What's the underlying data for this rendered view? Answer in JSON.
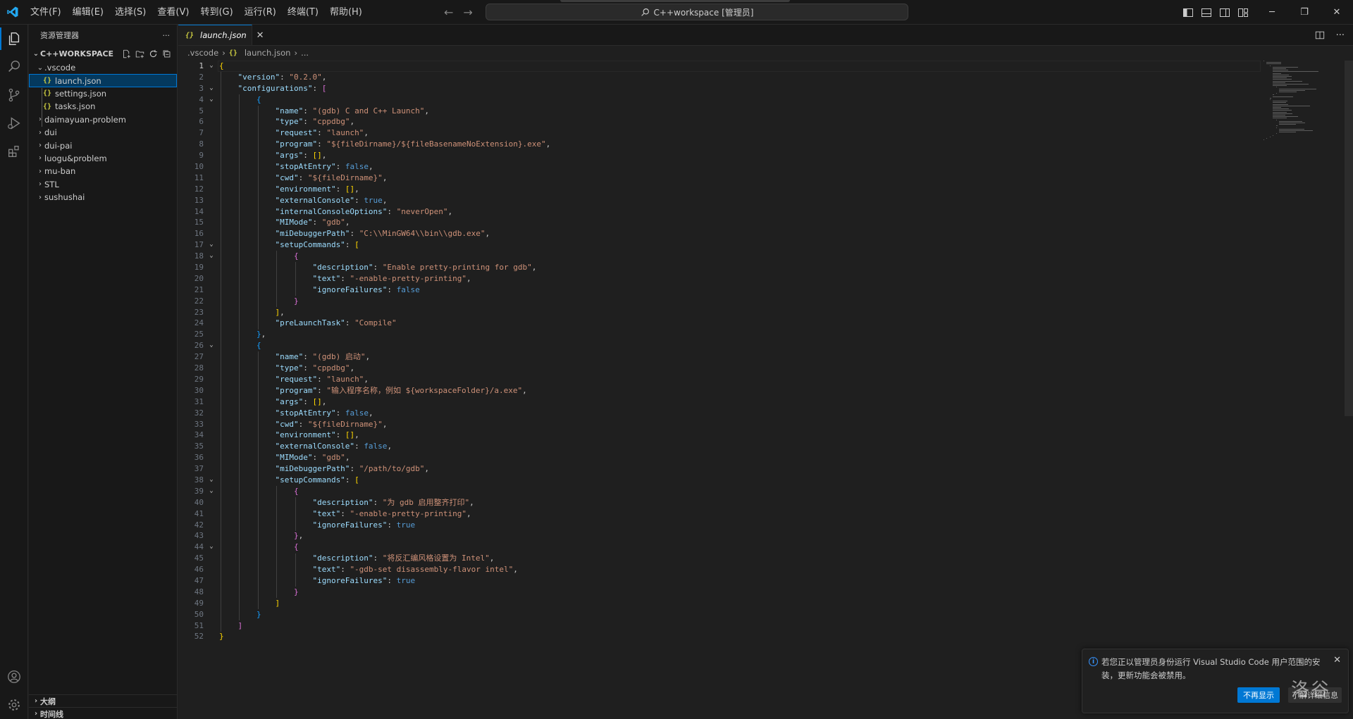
{
  "titlebar": {
    "menu": [
      "文件(F)",
      "编辑(E)",
      "选择(S)",
      "查看(V)",
      "转到(G)",
      "运行(R)",
      "终端(T)",
      "帮助(H)"
    ],
    "command_center": "C++workspace [管理员]"
  },
  "sidebar": {
    "title": "资源管理器",
    "more": "···",
    "workspace": "C++WORKSPACE",
    "folder_open": ".vscode",
    "files": [
      "launch.json",
      "settings.json",
      "tasks.json"
    ],
    "folders": [
      "daimayuan-problem",
      "dui",
      "dui-pai",
      "luogu&problem",
      "mu-ban",
      "STL",
      "sushushai"
    ],
    "outline": "大纲",
    "timeline": "时间线"
  },
  "editor": {
    "tab": "launch.json",
    "breadcrumb": [
      ".vscode",
      "launch.json",
      "..."
    ],
    "active_line": 1,
    "lines": [
      [
        [
          "b1",
          "{"
        ]
      ],
      [
        [
          "key",
          "    \"version\""
        ],
        [
          "p",
          ": "
        ],
        [
          "str",
          "\"0.2.0\""
        ],
        [
          "p",
          ","
        ]
      ],
      [
        [
          "key",
          "    \"configurations\""
        ],
        [
          "p",
          ": "
        ],
        [
          "b2",
          "["
        ]
      ],
      [
        [
          "p",
          "        "
        ],
        [
          "b3",
          "{"
        ]
      ],
      [
        [
          "key",
          "            \"name\""
        ],
        [
          "p",
          ": "
        ],
        [
          "str",
          "\"(gdb) C and C++ Launch\""
        ],
        [
          "p",
          ","
        ]
      ],
      [
        [
          "key",
          "            \"type\""
        ],
        [
          "p",
          ": "
        ],
        [
          "str",
          "\"cppdbg\""
        ],
        [
          "p",
          ","
        ]
      ],
      [
        [
          "key",
          "            \"request\""
        ],
        [
          "p",
          ": "
        ],
        [
          "str",
          "\"launch\""
        ],
        [
          "p",
          ","
        ]
      ],
      [
        [
          "key",
          "            \"program\""
        ],
        [
          "p",
          ": "
        ],
        [
          "str",
          "\"${fileDirname}/${fileBasenameNoExtension}.exe\""
        ],
        [
          "p",
          ","
        ]
      ],
      [
        [
          "key",
          "            \"args\""
        ],
        [
          "p",
          ": "
        ],
        [
          "b1",
          "[]"
        ],
        [
          "p",
          ","
        ]
      ],
      [
        [
          "key",
          "            \"stopAtEntry\""
        ],
        [
          "p",
          ": "
        ],
        [
          "kw",
          "false"
        ],
        [
          "p",
          ","
        ]
      ],
      [
        [
          "key",
          "            \"cwd\""
        ],
        [
          "p",
          ": "
        ],
        [
          "str",
          "\"${fileDirname}\""
        ],
        [
          "p",
          ","
        ]
      ],
      [
        [
          "key",
          "            \"environment\""
        ],
        [
          "p",
          ": "
        ],
        [
          "b1",
          "[]"
        ],
        [
          "p",
          ","
        ]
      ],
      [
        [
          "key",
          "            \"externalConsole\""
        ],
        [
          "p",
          ": "
        ],
        [
          "kw",
          "true"
        ],
        [
          "p",
          ","
        ]
      ],
      [
        [
          "key",
          "            \"internalConsoleOptions\""
        ],
        [
          "p",
          ": "
        ],
        [
          "str",
          "\"neverOpen\""
        ],
        [
          "p",
          ","
        ]
      ],
      [
        [
          "key",
          "            \"MIMode\""
        ],
        [
          "p",
          ": "
        ],
        [
          "str",
          "\"gdb\""
        ],
        [
          "p",
          ","
        ]
      ],
      [
        [
          "key",
          "            \"miDebuggerPath\""
        ],
        [
          "p",
          ": "
        ],
        [
          "str",
          "\"C:\\\\MinGW64\\\\bin\\\\gdb.exe\""
        ],
        [
          "p",
          ","
        ]
      ],
      [
        [
          "key",
          "            \"setupCommands\""
        ],
        [
          "p",
          ": "
        ],
        [
          "b1",
          "["
        ]
      ],
      [
        [
          "p",
          "                "
        ],
        [
          "b2",
          "{"
        ]
      ],
      [
        [
          "key",
          "                    \"description\""
        ],
        [
          "p",
          ": "
        ],
        [
          "str",
          "\"Enable pretty-printing for gdb\""
        ],
        [
          "p",
          ","
        ]
      ],
      [
        [
          "key",
          "                    \"text\""
        ],
        [
          "p",
          ": "
        ],
        [
          "str",
          "\"-enable-pretty-printing\""
        ],
        [
          "p",
          ","
        ]
      ],
      [
        [
          "key",
          "                    \"ignoreFailures\""
        ],
        [
          "p",
          ": "
        ],
        [
          "kw",
          "false"
        ]
      ],
      [
        [
          "p",
          "                "
        ],
        [
          "b2",
          "}"
        ]
      ],
      [
        [
          "p",
          "            "
        ],
        [
          "b1",
          "]"
        ],
        [
          "p",
          ","
        ]
      ],
      [
        [
          "key",
          "            \"preLaunchTask\""
        ],
        [
          "p",
          ": "
        ],
        [
          "str",
          "\"Compile\""
        ]
      ],
      [
        [
          "p",
          "        "
        ],
        [
          "b3",
          "}"
        ],
        [
          "p",
          ","
        ]
      ],
      [
        [
          "p",
          "        "
        ],
        [
          "b3",
          "{"
        ]
      ],
      [
        [
          "key",
          "            \"name\""
        ],
        [
          "p",
          ": "
        ],
        [
          "str",
          "\"(gdb) 启动\""
        ],
        [
          "p",
          ","
        ]
      ],
      [
        [
          "key",
          "            \"type\""
        ],
        [
          "p",
          ": "
        ],
        [
          "str",
          "\"cppdbg\""
        ],
        [
          "p",
          ","
        ]
      ],
      [
        [
          "key",
          "            \"request\""
        ],
        [
          "p",
          ": "
        ],
        [
          "str",
          "\"launch\""
        ],
        [
          "p",
          ","
        ]
      ],
      [
        [
          "key",
          "            \"program\""
        ],
        [
          "p",
          ": "
        ],
        [
          "str",
          "\"输入程序名称，例如 ${workspaceFolder}/a.exe\""
        ],
        [
          "p",
          ","
        ]
      ],
      [
        [
          "key",
          "            \"args\""
        ],
        [
          "p",
          ": "
        ],
        [
          "b1",
          "[]"
        ],
        [
          "p",
          ","
        ]
      ],
      [
        [
          "key",
          "            \"stopAtEntry\""
        ],
        [
          "p",
          ": "
        ],
        [
          "kw",
          "false"
        ],
        [
          "p",
          ","
        ]
      ],
      [
        [
          "key",
          "            \"cwd\""
        ],
        [
          "p",
          ": "
        ],
        [
          "str",
          "\"${fileDirname}\""
        ],
        [
          "p",
          ","
        ]
      ],
      [
        [
          "key",
          "            \"environment\""
        ],
        [
          "p",
          ": "
        ],
        [
          "b1",
          "[]"
        ],
        [
          "p",
          ","
        ]
      ],
      [
        [
          "key",
          "            \"externalConsole\""
        ],
        [
          "p",
          ": "
        ],
        [
          "kw",
          "false"
        ],
        [
          "p",
          ","
        ]
      ],
      [
        [
          "key",
          "            \"MIMode\""
        ],
        [
          "p",
          ": "
        ],
        [
          "str",
          "\"gdb\""
        ],
        [
          "p",
          ","
        ]
      ],
      [
        [
          "key",
          "            \"miDebuggerPath\""
        ],
        [
          "p",
          ": "
        ],
        [
          "str",
          "\"/path/to/gdb\""
        ],
        [
          "p",
          ","
        ]
      ],
      [
        [
          "key",
          "            \"setupCommands\""
        ],
        [
          "p",
          ": "
        ],
        [
          "b1",
          "["
        ]
      ],
      [
        [
          "p",
          "                "
        ],
        [
          "b2",
          "{"
        ]
      ],
      [
        [
          "key",
          "                    \"description\""
        ],
        [
          "p",
          ": "
        ],
        [
          "str",
          "\"为 gdb 启用整齐打印\""
        ],
        [
          "p",
          ","
        ]
      ],
      [
        [
          "key",
          "                    \"text\""
        ],
        [
          "p",
          ": "
        ],
        [
          "str",
          "\"-enable-pretty-printing\""
        ],
        [
          "p",
          ","
        ]
      ],
      [
        [
          "key",
          "                    \"ignoreFailures\""
        ],
        [
          "p",
          ": "
        ],
        [
          "kw",
          "true"
        ]
      ],
      [
        [
          "p",
          "                "
        ],
        [
          "b2",
          "}"
        ],
        [
          "p",
          ","
        ]
      ],
      [
        [
          "p",
          "                "
        ],
        [
          "b2",
          "{"
        ]
      ],
      [
        [
          "key",
          "                    \"description\""
        ],
        [
          "p",
          ": "
        ],
        [
          "str",
          "\"将反汇编风格设置为 Intel\""
        ],
        [
          "p",
          ","
        ]
      ],
      [
        [
          "key",
          "                    \"text\""
        ],
        [
          "p",
          ": "
        ],
        [
          "str",
          "\"-gdb-set disassembly-flavor intel\""
        ],
        [
          "p",
          ","
        ]
      ],
      [
        [
          "key",
          "                    \"ignoreFailures\""
        ],
        [
          "p",
          ": "
        ],
        [
          "kw",
          "true"
        ]
      ],
      [
        [
          "p",
          "                "
        ],
        [
          "b2",
          "}"
        ]
      ],
      [
        [
          "p",
          "            "
        ],
        [
          "b1",
          "]"
        ]
      ],
      [
        [
          "p",
          "        "
        ],
        [
          "b3",
          "}"
        ]
      ],
      [
        [
          "p",
          "    "
        ],
        [
          "b2",
          "]"
        ]
      ],
      [
        [
          "b1",
          "}"
        ]
      ]
    ],
    "fold_lines": [
      1,
      3,
      4,
      17,
      18,
      26,
      38,
      39,
      44
    ]
  },
  "notification": {
    "message": "若您正以管理员身份运行 Visual Studio Code 用户范围的安装，更新功能会被禁用。",
    "primary": "不再显示",
    "secondary": "了解详细信息"
  },
  "watermark": "洛谷",
  "colors": {
    "accent": "#0078d4",
    "key": "#9cdcfe",
    "string": "#ce9178",
    "keyword": "#569cd6"
  }
}
